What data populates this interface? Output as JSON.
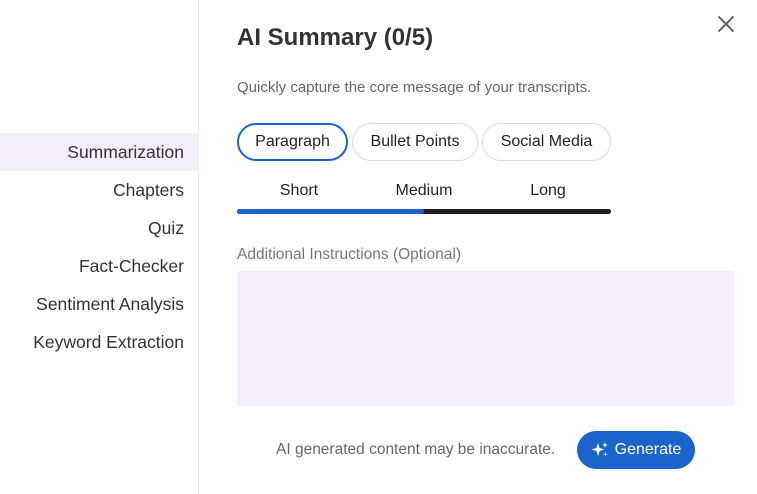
{
  "sidebar": {
    "items": [
      {
        "label": "Summarization",
        "active": true
      },
      {
        "label": "Chapters",
        "active": false
      },
      {
        "label": "Quiz",
        "active": false
      },
      {
        "label": "Fact-Checker",
        "active": false
      },
      {
        "label": "Sentiment Analysis",
        "active": false
      },
      {
        "label": "Keyword Extraction",
        "active": false
      }
    ]
  },
  "header": {
    "title": "AI Summary (0/5)",
    "subtitle": "Quickly capture the core message of your transcripts.",
    "close_icon": "close-icon"
  },
  "format": {
    "options": [
      "Paragraph",
      "Bullet Points",
      "Social Media"
    ],
    "selected": "Paragraph"
  },
  "length": {
    "options": [
      "Short",
      "Medium",
      "Long"
    ],
    "selected": "Short",
    "slider_fraction": 0.5
  },
  "instructions": {
    "label": "Additional Instructions (Optional)",
    "value": "",
    "placeholder": ""
  },
  "footer": {
    "disclaimer": "AI generated content may be inaccurate.",
    "generate_label": "Generate",
    "generate_icon": "sparkle-icon"
  },
  "colors": {
    "accent": "#1b64c9",
    "active_bg": "#f6eefa",
    "track": "#1e1e1e"
  }
}
